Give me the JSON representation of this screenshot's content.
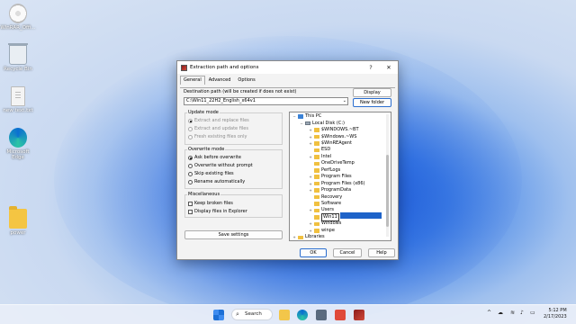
{
  "desktop": {
    "icons": [
      {
        "label": "WinRAR_Offi...",
        "icon": "disc-icon"
      },
      {
        "label": "Recycle Bin",
        "icon": "recycle-bin-icon"
      },
      {
        "label": "new text.txt",
        "icon": "text-file-icon"
      },
      {
        "label": "Microsoft Edge",
        "icon": "edge-icon"
      },
      {
        "label": "power",
        "icon": "folder-icon"
      }
    ]
  },
  "dialog": {
    "title": "Extraction path and options",
    "help_label": "?",
    "close_label": "✕",
    "tabs": [
      {
        "label": "General",
        "active": true
      },
      {
        "label": "Advanced",
        "active": false
      },
      {
        "label": "Options",
        "active": false
      }
    ],
    "destination_label": "Destination path (will be created if does not exist)",
    "destination_value": "C:\\Win11_22H2_English_x64v1",
    "display_button": "Display",
    "new_folder_button": "New folder",
    "update_mode": {
      "title": "Update mode",
      "options": [
        {
          "label": "Extract and replace files",
          "selected": true,
          "disabled": true
        },
        {
          "label": "Extract and update files",
          "selected": false,
          "disabled": true
        },
        {
          "label": "Fresh existing files only",
          "selected": false,
          "disabled": true
        }
      ]
    },
    "overwrite_mode": {
      "title": "Overwrite mode",
      "options": [
        {
          "label": "Ask before overwrite",
          "selected": true
        },
        {
          "label": "Overwrite without prompt",
          "selected": false
        },
        {
          "label": "Skip existing files",
          "selected": false
        },
        {
          "label": "Rename automatically",
          "selected": false
        }
      ]
    },
    "miscellaneous": {
      "title": "Miscellaneous",
      "options": [
        {
          "label": "Keep broken files",
          "checked": false
        },
        {
          "label": "Display files in Explorer",
          "checked": false
        }
      ]
    },
    "save_settings_button": "Save settings",
    "tree": [
      {
        "label": "This PC",
        "level": 0,
        "expander": "−",
        "icon": "pc"
      },
      {
        "label": "Local Disk (C:)",
        "level": 1,
        "expander": "−",
        "icon": "disk"
      },
      {
        "label": "$WINDOWS.~BT",
        "level": 2,
        "expander": "+",
        "icon": "folder"
      },
      {
        "label": "$Windows.~WS",
        "level": 2,
        "expander": "+",
        "icon": "folder"
      },
      {
        "label": "$WinREAgent",
        "level": 2,
        "expander": "+",
        "icon": "folder"
      },
      {
        "label": "ESD",
        "level": 2,
        "expander": "",
        "icon": "folder"
      },
      {
        "label": "Intel",
        "level": 2,
        "expander": "+",
        "icon": "folder"
      },
      {
        "label": "OneDriveTemp",
        "level": 2,
        "expander": "",
        "icon": "folder"
      },
      {
        "label": "PerfLogs",
        "level": 2,
        "expander": "",
        "icon": "folder"
      },
      {
        "label": "Program Files",
        "level": 2,
        "expander": "+",
        "icon": "folder"
      },
      {
        "label": "Program Files (x86)",
        "level": 2,
        "expander": "+",
        "icon": "folder"
      },
      {
        "label": "ProgramData",
        "level": 2,
        "expander": "+",
        "icon": "folder"
      },
      {
        "label": "Recovery",
        "level": 2,
        "expander": "",
        "icon": "folder"
      },
      {
        "label": "Software",
        "level": 2,
        "expander": "",
        "icon": "folder"
      },
      {
        "label": "Users",
        "level": 2,
        "expander": "+",
        "icon": "folder"
      },
      {
        "label": "Win11",
        "level": 2,
        "expander": "",
        "icon": "folder",
        "editing": true
      },
      {
        "label": "Windows",
        "level": 2,
        "expander": "+",
        "icon": "folder"
      },
      {
        "label": "winpe",
        "level": 2,
        "expander": "+",
        "icon": "folder"
      },
      {
        "label": "Libraries",
        "level": 0,
        "expander": "+",
        "icon": "folder"
      }
    ],
    "ok_button": "OK",
    "cancel_button": "Cancel",
    "help_button": "Help"
  },
  "taskbar": {
    "search_label": "Search",
    "tray_chevron": "^",
    "clock_time": "5:12 PM",
    "clock_date": "2/17/2023"
  }
}
